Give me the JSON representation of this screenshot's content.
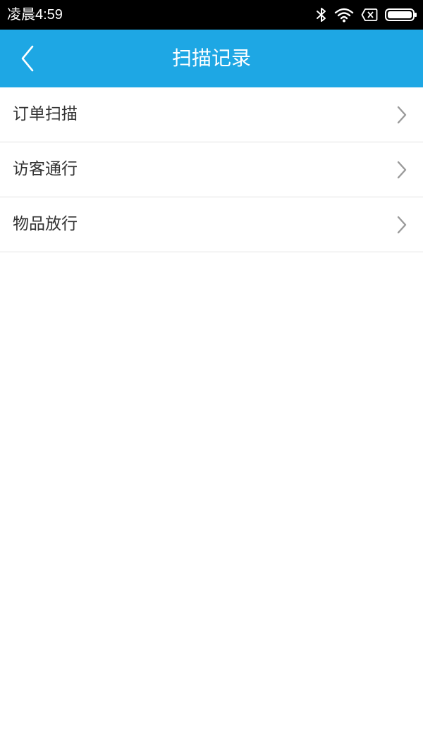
{
  "status_bar": {
    "time": "凌晨4:59",
    "icons": [
      "bluetooth-icon",
      "wifi-icon",
      "sim-card-absent-icon",
      "battery-icon"
    ]
  },
  "nav": {
    "title": "扫描记录",
    "back_icon": "chevron-left-icon"
  },
  "menu": {
    "items": [
      {
        "label": "订单扫描",
        "icon": "chevron-right-icon"
      },
      {
        "label": "访客通行",
        "icon": "chevron-right-icon"
      },
      {
        "label": "物品放行",
        "icon": "chevron-right-icon"
      }
    ]
  },
  "colors": {
    "nav_background": "#1ea7e4",
    "status_background": "#000000",
    "divider": "#e3e3e3",
    "item_text": "#333333",
    "chevron": "#9a9a9a"
  }
}
